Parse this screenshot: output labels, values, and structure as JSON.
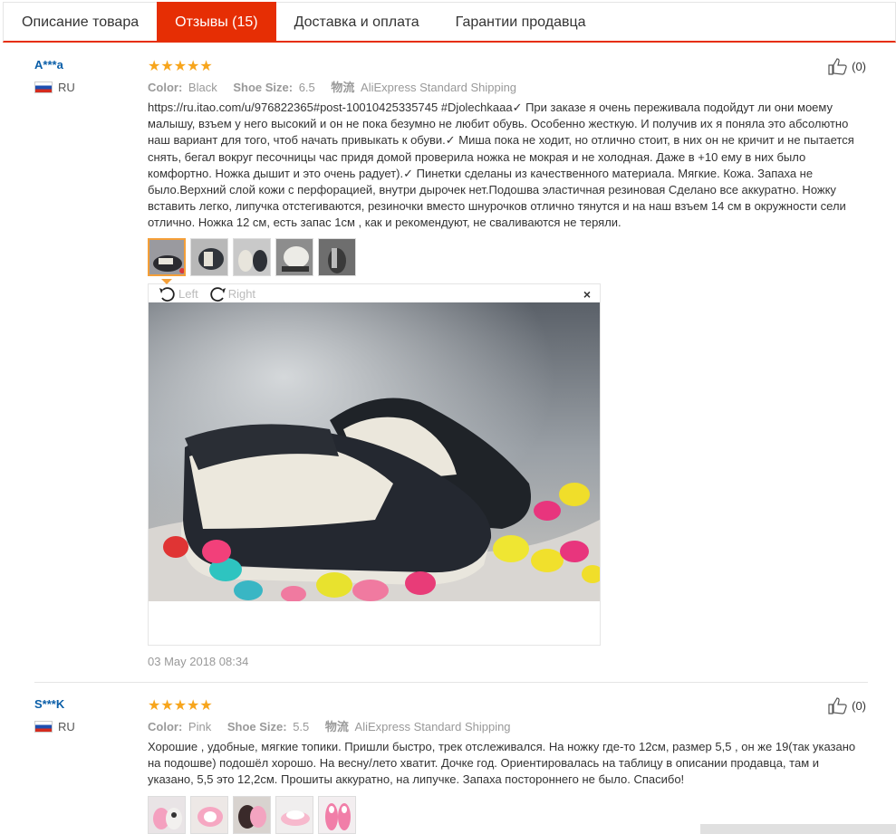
{
  "tabs": [
    {
      "label": "Описание товара",
      "active": false
    },
    {
      "label": "Отзывы (15)",
      "active": true
    },
    {
      "label": "Доставка и оплата",
      "active": false
    },
    {
      "label": "Гарантии продавца",
      "active": false
    }
  ],
  "reviews": [
    {
      "user": "A***a",
      "country": "RU",
      "stars": "★★★★★",
      "rating": 5,
      "color_label": "Color:",
      "color": "Black",
      "size_label": "Shoe Size:",
      "size": "6.5",
      "shipping_label": "物流",
      "shipping": "AliExpress Standard Shipping",
      "helpful": "(0)",
      "text": "https://ru.itao.com/u/976822365#post-10010425335745 #Djolechkaaa✓ При заказе я очень переживала подойдут ли они моему малышу, взъем у него высокий и он не пока безумно не любит обувь. Особенно жесткую. И получив их я поняла это абсолютно наш вариант для того, чтоб начать привыкать к обуви.✓ Миша пока не ходит, но отлично стоит, в них он не кричит и не пытается снять, бегал вокруг песочницы час придя домой проверила ножка не мокрая и не холодная. Даже в +10 ему в них было комфортно. Ножка дышит и это очень радует).✓ Пинетки сделаны из качественного материала. Мягкие. Кожа. Запаха не было.Верхний слой кожи с перфорацией, внутри дырочек нет.Подошва эластичная резиновая Сделано все аккуратно. Ножку вставить легко, липучка отстегиваются, резиночки вместо шнурочков отлично тянутся и на наш взъем 14 см в окружности сели отлично. Ножка 12 см, есть запас 1см , как и рекомендуют, не сваливаются не теряли.",
      "viewer": {
        "left_label": "Left",
        "right_label": "Right",
        "close": "×"
      },
      "date": "03 May 2018 08:34"
    },
    {
      "user": "S***K",
      "country": "RU",
      "stars": "★★★★★",
      "rating": 5,
      "color_label": "Color:",
      "color": "Pink",
      "size_label": "Shoe Size:",
      "size": "5.5",
      "shipping_label": "物流",
      "shipping": "AliExpress Standard Shipping",
      "helpful": "(0)",
      "text": "Хорошие , удобные, мягкие топики. Пришли быстро, трек отслеживался. На ножку где-то 12см, размер 5,5 , он же 19(так указано на подошве) подошёл хорошо. На весну/лето хватит. Дочке год. Ориентировалась на таблицу в описании продавца, там и указано, 5,5 это 12,2см. Прошиты аккуратно, на липучке. Запаха постороннего не было. Спасибо!"
    }
  ],
  "colors": {
    "accent": "#e62e04",
    "star": "#f7a51c",
    "link": "#0a5ea8"
  }
}
